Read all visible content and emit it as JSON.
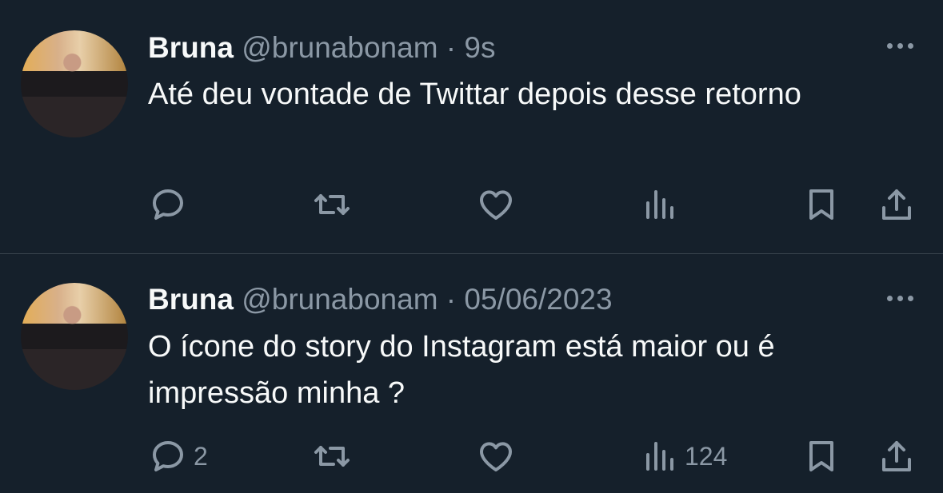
{
  "tweets": [
    {
      "name": "Bruna",
      "handle": "@brunabonam",
      "separator": "·",
      "time": "9s",
      "text": "Até deu vontade de Twittar depois desse retorno",
      "reply_count": "",
      "retweet_count": "",
      "like_count": "",
      "view_count": ""
    },
    {
      "name": "Bruna",
      "handle": "@brunabonam",
      "separator": "·",
      "time": "05/06/2023",
      "text": "O ícone do story do Instagram está maior ou é impressão minha ?",
      "reply_count": "2",
      "retweet_count": "",
      "like_count": "",
      "view_count": "124"
    }
  ],
  "icons": {
    "reply": "reply-icon",
    "retweet": "retweet-icon",
    "like": "heart-icon",
    "views": "views-icon",
    "bookmark": "bookmark-icon",
    "share": "share-icon",
    "more": "more-icon"
  },
  "colors": {
    "background": "#15202b",
    "text": "#f7f9f9",
    "secondary": "#8b98a5",
    "divider": "#38444d"
  }
}
